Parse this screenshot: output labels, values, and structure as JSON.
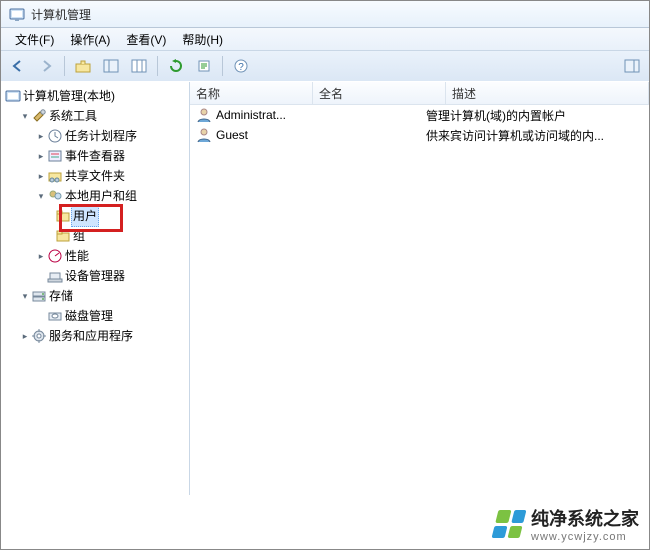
{
  "window": {
    "title": "计算机管理"
  },
  "menu": {
    "file": "文件(F)",
    "action": "操作(A)",
    "view": "查看(V)",
    "help": "帮助(H)"
  },
  "toolbar_icons": {
    "back": "back-icon",
    "forward": "forward-icon",
    "up": "up-icon",
    "show_hide_tree": "show-hide-tree-icon",
    "properties": "properties-icon",
    "refresh": "refresh-icon",
    "export": "export-icon",
    "help": "help-icon"
  },
  "tree": {
    "root": "计算机管理(本地)",
    "system_tools": "系统工具",
    "task_scheduler": "任务计划程序",
    "event_viewer": "事件查看器",
    "shared_folders": "共享文件夹",
    "local_users_groups": "本地用户和组",
    "users": "用户",
    "groups": "组",
    "performance": "性能",
    "device_manager": "设备管理器",
    "storage": "存储",
    "disk_management": "磁盘管理",
    "services_apps": "服务和应用程序"
  },
  "list": {
    "columns": {
      "name": "名称",
      "full_name": "全名",
      "description": "描述"
    },
    "rows": [
      {
        "name": "Administrat...",
        "full_name": "",
        "description": "管理计算机(域)的内置帐户"
      },
      {
        "name": "Guest",
        "full_name": "",
        "description": "供来宾访问计算机或访问域的内..."
      }
    ]
  },
  "watermark": {
    "title": "纯净系统之家",
    "url": "www.ycwjzy.com"
  }
}
